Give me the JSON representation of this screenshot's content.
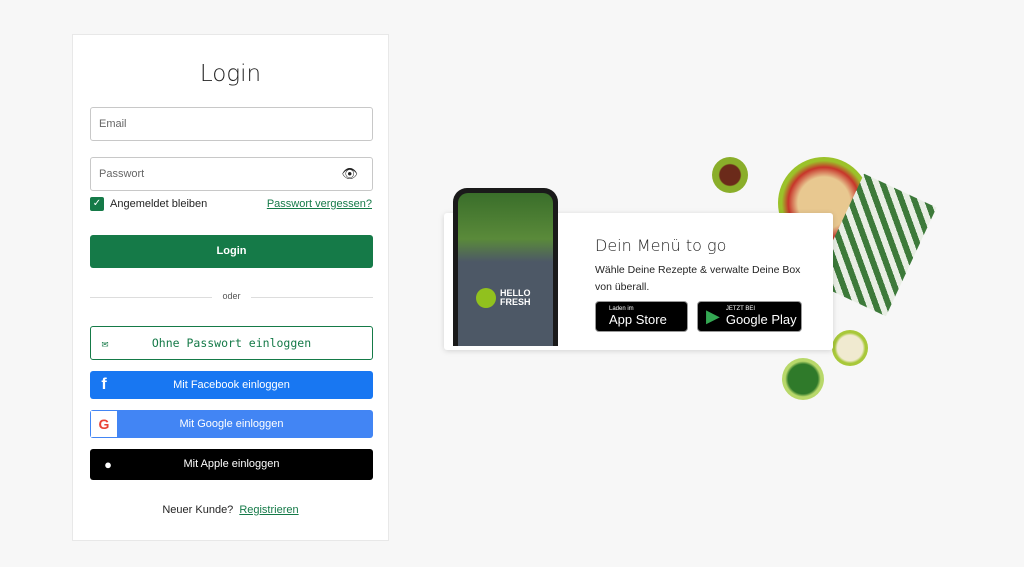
{
  "login": {
    "title": "Login",
    "email_placeholder": "Email",
    "password_placeholder": "Passwort",
    "remember": "Angemeldet bleiben",
    "forgot": "Passwort vergessen?",
    "login_button": "Login",
    "divider": "oder",
    "passwordless": "Ohne Passwort einloggen",
    "facebook": "Mit Facebook einloggen",
    "google": "Mit Google einloggen",
    "apple": "Mit Apple einloggen",
    "new_customer": "Neuer Kunde?",
    "register": "Registrieren"
  },
  "promo": {
    "title": "Dein Menü to go",
    "text": "Wähle Deine Rezepte & verwalte Deine Box von überall.",
    "logo": "HELLO FRESH",
    "appstore_small": "Laden im",
    "appstore": "App Store",
    "googleplay_small": "JETZT BEI",
    "googleplay": "Google Play"
  },
  "colors": {
    "brand": "#157a48",
    "facebook": "#1877f2",
    "google": "#4285f4",
    "apple": "#000000"
  }
}
